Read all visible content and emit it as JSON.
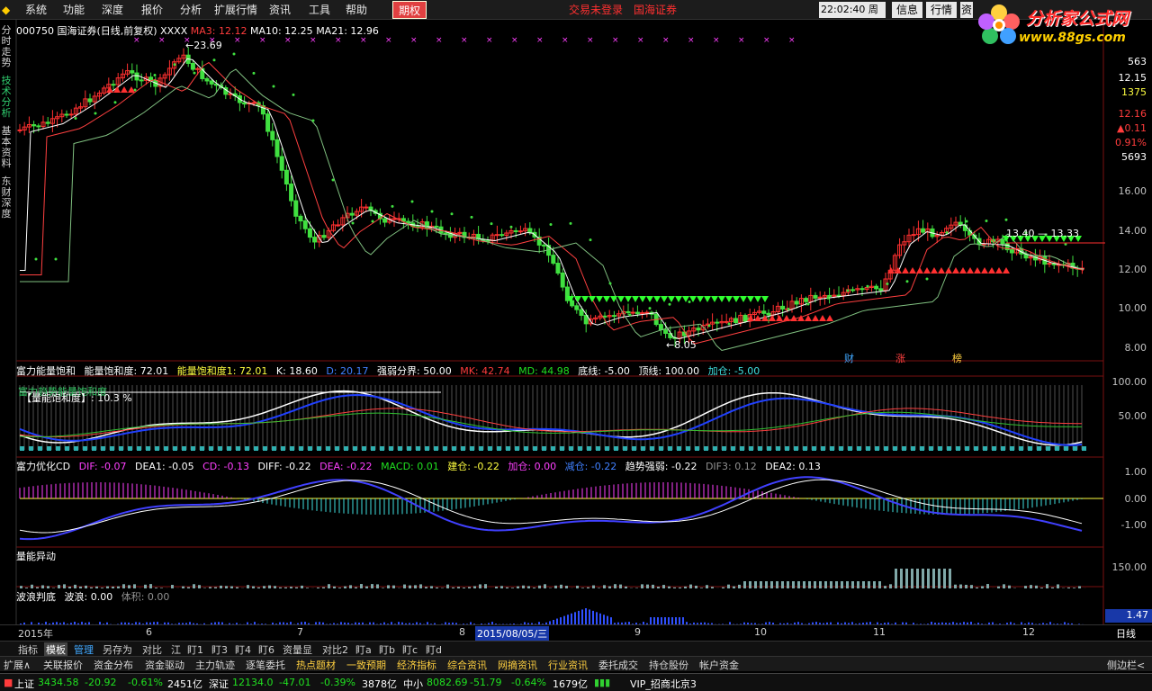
{
  "menu": {
    "items": [
      "系统",
      "功能",
      "深度",
      "报价",
      "分析",
      "扩展行情",
      "资讯",
      "工具",
      "帮助"
    ],
    "active": "期权",
    "status": "交易未登录",
    "broker": "国海证券",
    "time": "22:02:40",
    "weekday": "周日",
    "buttons": [
      "信息",
      "行情",
      "资"
    ]
  },
  "logo": {
    "name": "分析家公式网",
    "url": "www.88gs.com"
  },
  "leftnav": [
    "分时走势",
    "技术分析",
    "基本资料",
    "东财深度"
  ],
  "main": {
    "code": "000750",
    "name": "国海证券(日线,前复权)",
    "xxxx": "XXXX",
    "ma3": "MA3: 12.12",
    "ma10": "MA10: 12.25",
    "ma21": "MA21: 12.96",
    "high_label": "23.69",
    "low_label": "8.05",
    "band_label": "13.40 — 13.33",
    "right_info": [
      "563",
      "12.15",
      "1375",
      "12.16",
      "▲0.11",
      "0.91%",
      "5693"
    ],
    "yticks": [
      "16.00",
      "14.00",
      "12.00",
      "10.00",
      "8.00"
    ],
    "badges": [
      "财",
      "涨",
      "榜"
    ]
  },
  "p1": {
    "title": "富力能量饱和",
    "t2": "能量饱和度: 72.01",
    "t3": "能量饱和度1: 72.01",
    "k": "K: 18.60",
    "d": "D: 20.17",
    "qr": "强弱分界: 50.00",
    "mk": "MK: 42.74",
    "md": "MD: 44.98",
    "dx": "底线: -5.00",
    "top": "顶线: 100.00",
    "jc": "加仓: -5.00",
    "sub1": "富力趋势能量饱和度",
    "sub2": "【量能饱和度】: 10.3 %",
    "yticks": [
      "100.00",
      "50.00"
    ]
  },
  "p2": {
    "title": "富力优化CD",
    "dif": "DIF: -0.07",
    "dea1": "DEA1: -0.05",
    "cd": "CD: -0.13",
    "diff": "DIFF: -0.22",
    "dea": "DEA: -0.22",
    "macd": "MACD: 0.01",
    "jc": "建仓: -0.22",
    "jia": "加仓: 0.00",
    "jian": "减仓: -0.22",
    "qs": "趋势强弱: -0.22",
    "dif3": "DIF3: 0.12",
    "dea2": "DEA2: 0.13",
    "yticks": [
      "1.00",
      "0.00",
      "-1.00"
    ]
  },
  "p3": {
    "title": "量能异动",
    "ytick": "150.00"
  },
  "p4": {
    "title": "波浪判底",
    "w1": "波浪: 0.00",
    "w2": "体积: 0.00",
    "val": "1.47"
  },
  "timeaxis": {
    "labels": [
      "2015年",
      "6",
      "7",
      "8",
      "2015/08/05/三",
      "9",
      "10",
      "11",
      "12"
    ],
    "right": "日线"
  },
  "tabs": [
    "指标",
    "模板",
    "管理",
    "另存为",
    "对比",
    "江",
    "盯1",
    "盯3",
    "盯4",
    "盯6",
    "资量显",
    "对比2",
    "盯a",
    "盯b",
    "盯c",
    "盯d"
  ],
  "quick": [
    "扩展∧",
    "关联报价",
    "资金分布",
    "资金驱动",
    "主力轨迹",
    "逐笔委托",
    "热点题材",
    "一致预期",
    "经济指标",
    "综合资讯",
    "网摘资讯",
    "行业资讯",
    "委托成交",
    "持仓股份",
    "帐户资金"
  ],
  "quick_right": "侧边栏<",
  "status": {
    "sh": "上证",
    "sh_v": "3434.58",
    "sh_c": "-20.92",
    "sh_p": "-0.61%",
    "sh_a": "2451亿",
    "sz": "深证",
    "sz_v": "12134.0",
    "sz_c": "-47.01",
    "sz_p": "-0.39%",
    "sz_a": "3878亿",
    "zx": "中小",
    "zx_v": "8082.69",
    "zx_c": "-51.79",
    "zx_p": "-0.64%",
    "zx_a": "1679亿",
    "vip": "VIP_招商北京3"
  }
}
